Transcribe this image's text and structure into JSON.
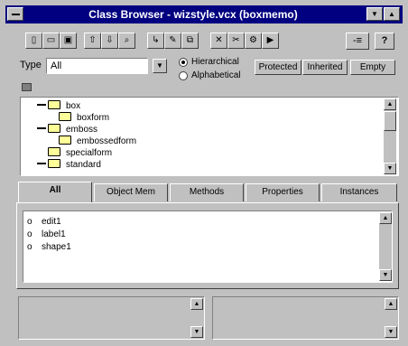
{
  "window": {
    "title": "Class Browser - wizstyle.vcx (boxmemo)"
  },
  "title_buttons": {
    "minimize": "▼",
    "maximize": "▲"
  },
  "toolbar": {
    "tools": [
      "new",
      "open",
      "save",
      "export",
      "import",
      "find",
      "redefine",
      "rename",
      "dup",
      "delete",
      "cleanup",
      "modify",
      "run"
    ],
    "pin_label": "-≡",
    "help_label": "?"
  },
  "filter": {
    "type_label": "Type",
    "type_value": "All",
    "dropdown_glyph": "▼"
  },
  "view_mode": {
    "hierarchical": "Hierarchical",
    "alphabetical": "Alphabetical",
    "selected": "hierarchical"
  },
  "buttons": {
    "protected": "Protected",
    "inherited": "Inherited",
    "empty": "Empty"
  },
  "tree": {
    "items": [
      {
        "label": "box",
        "level": 0,
        "expanded": true
      },
      {
        "label": "boxform",
        "level": 1,
        "expanded": false
      },
      {
        "label": "emboss",
        "level": 0,
        "expanded": true
      },
      {
        "label": "embossedform",
        "level": 1,
        "expanded": false
      },
      {
        "label": "specialform",
        "level": 0,
        "expanded": false
      },
      {
        "label": "standard",
        "level": 0,
        "expanded": true
      }
    ]
  },
  "tabs": [
    {
      "label": "All",
      "active": true
    },
    {
      "label": "Object Mem",
      "active": false
    },
    {
      "label": "Methods",
      "active": false
    },
    {
      "label": "Properties",
      "active": false
    },
    {
      "label": "Instances",
      "active": false
    }
  ],
  "members": [
    {
      "bullet": "o",
      "label": "edit1"
    },
    {
      "bullet": "o",
      "label": "label1"
    },
    {
      "bullet": "o",
      "label": "shape1"
    }
  ],
  "scroll": {
    "up": "▲",
    "down": "▼"
  }
}
